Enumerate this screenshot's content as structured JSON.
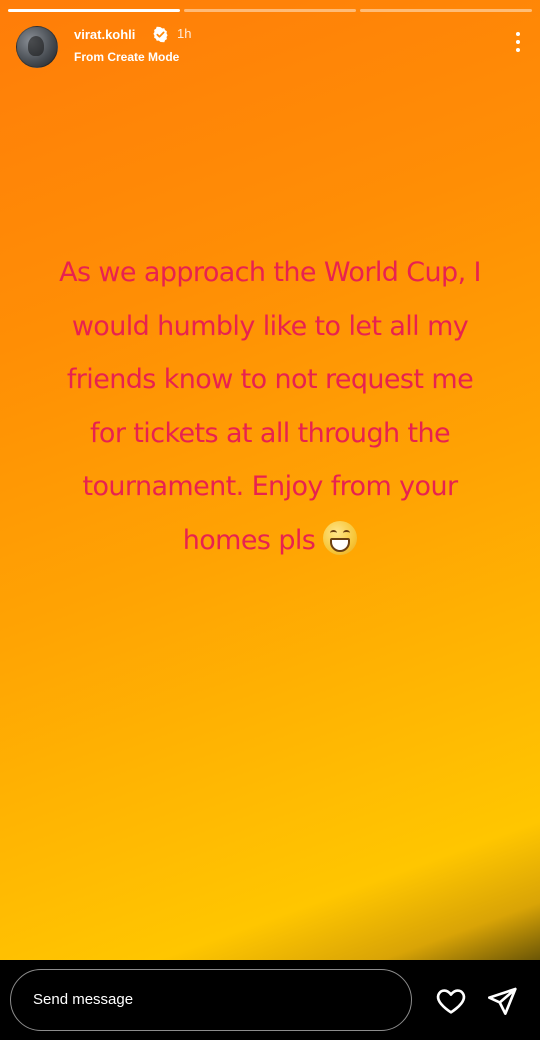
{
  "story": {
    "progress_total": 3,
    "progress_current": 1,
    "user": {
      "username": "virat.kohli",
      "verified": true,
      "time_ago": "1h",
      "subtitle": "From Create Mode"
    },
    "message_lines": [
      "As we approach the World Cup, I",
      "would humbly like to let all my",
      "friends know to not request me",
      "for tickets at all through the",
      "tournament. Enjoy from your",
      "homes pls"
    ],
    "message_emoji": "grinning-face-with-smiling-eyes",
    "text_color": "#e8224f",
    "gradient_colors": [
      "#ff7d09",
      "#ffc600"
    ]
  },
  "footer": {
    "send_placeholder": "Send message",
    "like_icon": "heart-icon",
    "share_icon": "paper-plane-icon"
  }
}
